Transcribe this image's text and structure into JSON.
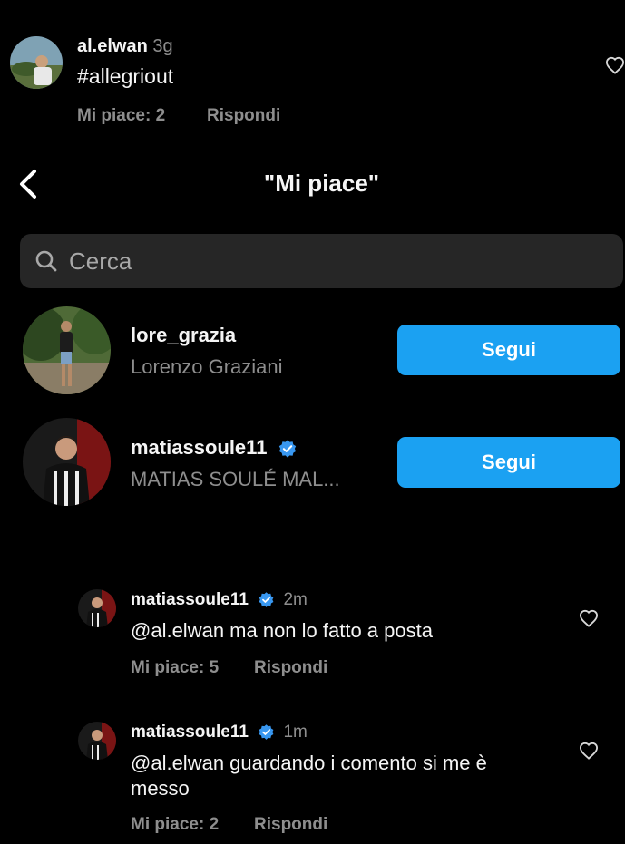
{
  "top_comment": {
    "username": "al.elwan",
    "time": "3g",
    "text": "#allegriout",
    "likes": "Mi piace: 2",
    "reply": "Rispondi"
  },
  "header": {
    "title": "\"Mi piace\"",
    "back_icon": "chevron-left-icon"
  },
  "search": {
    "placeholder": "Cerca",
    "icon": "search-icon"
  },
  "likers": [
    {
      "username": "lore_grazia",
      "fullname": "Lorenzo Graziani",
      "verified": false,
      "button": "Segui"
    },
    {
      "username": "matiassoule11",
      "fullname": "MATIAS SOULÉ MAL...",
      "verified": true,
      "button": "Segui"
    }
  ],
  "replies": [
    {
      "username": "matiassoule11",
      "verified": true,
      "time": "2m",
      "text": "@al.elwan ma non lo fatto a posta",
      "likes": "Mi piace: 5",
      "reply": "Rispondi"
    },
    {
      "username": "matiassoule11",
      "verified": true,
      "time": "1m",
      "text_line1": "@al.elwan guardando i comento si me è",
      "text_line2": "messo",
      "likes": "Mi piace: 2",
      "reply": "Rispondi"
    }
  ],
  "colors": {
    "background": "#000000",
    "follow_button": "#1ba1f2",
    "verified_badge": "#3897f0",
    "muted_text": "#8e8e8e",
    "search_bg": "#262626"
  }
}
